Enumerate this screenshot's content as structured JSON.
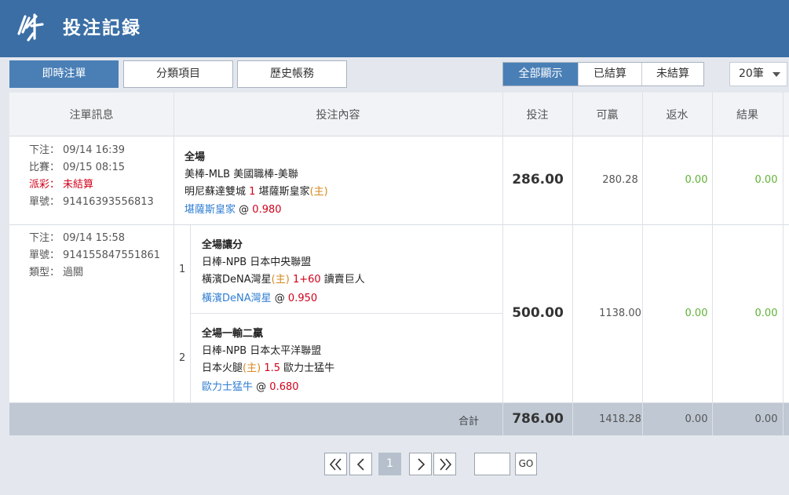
{
  "header": {
    "title": "投注記録",
    "logo_icon": "logo-icon"
  },
  "toolbar": {
    "tabs": [
      {
        "label": "即時注單",
        "active": true
      },
      {
        "label": "分類項目",
        "active": false
      },
      {
        "label": "歷史帳務",
        "active": false
      }
    ],
    "filters": [
      {
        "label": "全部顯示",
        "active": true
      },
      {
        "label": "已結算",
        "active": false
      },
      {
        "label": "未結算",
        "active": false
      }
    ],
    "page_size": "20筆"
  },
  "table": {
    "headers": [
      "注單訊息",
      "投注內容",
      "投注",
      "可贏",
      "返水",
      "結果"
    ],
    "rows": [
      {
        "info": [
          {
            "label": "下注：",
            "value": "09/14 16:39"
          },
          {
            "label": "比賽：",
            "value": "09/15 08:15"
          },
          {
            "label": "派彩：",
            "value": "未結算"
          },
          {
            "label": "單號：",
            "value": "91416393556813"
          }
        ],
        "bet_type": "全場",
        "league": "美棒-MLB 美國職棒-美聯",
        "home_team": "明尼蘇達雙城",
        "handicap": "1",
        "away_team": "堪薩斯皇家",
        "home_mark": "(主)",
        "pick": "堪薩斯皇家",
        "at": "@",
        "odds": "0.980",
        "stake": "286.00",
        "win": "280.28",
        "rebate": "0.00",
        "result": "0.00"
      },
      {
        "info": [
          {
            "label": "下注：",
            "value": "09/14 15:58"
          },
          {
            "label": "單號：",
            "value": "914155847551861"
          },
          {
            "label": "類型：",
            "value": "過關"
          }
        ],
        "legs": [
          {
            "index": "1",
            "bet_type": "全場讓分",
            "league": "日棒-NPB 日本中央聯盟",
            "team_a": "橫濱DeNA灣星",
            "home_mark": "(主)",
            "handicap": "1+60",
            "team_b": "讀賣巨人",
            "pick": "橫濱DeNA灣星",
            "at": "@",
            "odds": "0.950"
          },
          {
            "index": "2",
            "bet_type": "全場一輸二贏",
            "league": "日棒-NPB 日本太平洋聯盟",
            "team_a": "日本火腿",
            "home_mark": "(主)",
            "handicap": "1.5",
            "team_b": "歐力士猛牛",
            "pick": "歐力士猛牛",
            "at": "@",
            "odds": "0.680"
          }
        ],
        "stake": "500.00",
        "win": "1138.00",
        "rebate": "0.00",
        "result": "0.00"
      }
    ],
    "total": {
      "label": "合計",
      "stake": "786.00",
      "win": "1418.28",
      "rebate": "0.00",
      "result": "0.00"
    }
  },
  "pager": {
    "first_icon": "double-chevron-left-icon",
    "prev_icon": "chevron-left-icon",
    "current_page": "1",
    "next_icon": "chevron-right-icon",
    "last_icon": "double-chevron-right-icon",
    "go_label": "GO",
    "page_input": ""
  },
  "colors": {
    "header": "#3a6ea5",
    "accent": "#4a7fb6",
    "red": "#d0021b",
    "blue": "#2f7dd1",
    "green": "#5fb336",
    "orange": "#d68a1f"
  }
}
